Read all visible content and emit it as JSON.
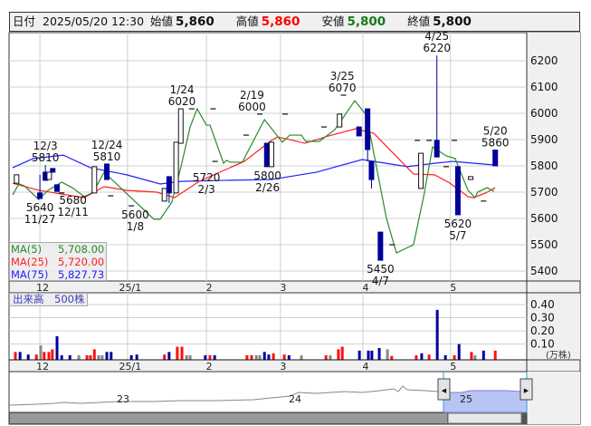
{
  "header": {
    "date_label": "日付",
    "datetime": "2025/05/20 12:30",
    "open_label": "始値",
    "open": "5,860",
    "high_label": "高値",
    "high": "5,860",
    "low_label": "安値",
    "low": "5,800",
    "close_label": "終値",
    "close": "5,800"
  },
  "colors": {
    "up": "#ffffff",
    "down": "#00009a",
    "ma5": "#2a8a2a",
    "ma25": "#ff2020",
    "ma75": "#2020ff",
    "vol_up": "#ff1010",
    "vol_down": "#0000a0",
    "vol_flat": "#888888",
    "high_value": "#ff0000",
    "low_value": "#1a7a1a"
  },
  "legend": [
    {
      "name": "MA(5)",
      "value": "5,708.00",
      "color": "#2a8a2a"
    },
    {
      "name": "MA(25)",
      "value": "5,720.00",
      "color": "#ff2020"
    },
    {
      "name": "MA(75)",
      "value": "5,827.73",
      "color": "#2020ff"
    }
  ],
  "volume_panel": {
    "title": "出来高　500株",
    "unit": "(万株)"
  },
  "navigator": {
    "year_labels": [
      "23",
      "24",
      "25"
    ]
  },
  "chart_data": {
    "type": "candlestick",
    "price_axis": {
      "ticks": [
        6200,
        6100,
        6000,
        5900,
        5800,
        5700,
        5600,
        5500,
        5400
      ]
    },
    "month_labels": [
      {
        "day": 7,
        "label": "12"
      },
      {
        "day": 29.5,
        "label": "25/1"
      },
      {
        "day": 49.8,
        "label": "2"
      },
      {
        "day": 68.8,
        "label": "3"
      },
      {
        "day": 90,
        "label": "4"
      },
      {
        "day": 112.5,
        "label": "5"
      }
    ],
    "candles": [
      {
        "day": 1,
        "o": 5734,
        "h": 5766,
        "l": 5734,
        "c": 5766
      },
      {
        "day": 7,
        "o": 5697,
        "h": 5766,
        "l": 5676,
        "c": 5676
      },
      {
        "day": 8.4,
        "o": 5776,
        "h": 5803,
        "l": 5745,
        "c": 5745
      },
      {
        "day": 9.4,
        "o": 5748,
        "h": 5776,
        "l": 5748,
        "c": 5776
      },
      {
        "day": 10.3,
        "o": 5790,
        "h": 5790,
        "l": 5776,
        "c": 5776
      },
      {
        "day": 11.4,
        "o": 5728,
        "h": 5728,
        "l": 5703,
        "c": 5703
      },
      {
        "day": 12.6,
        "o": 5697,
        "h": 5697,
        "l": 5697,
        "c": 5697
      },
      {
        "day": 21,
        "o": 5697,
        "h": 5797,
        "l": 5697,
        "c": 5797
      },
      {
        "day": 24.2,
        "o": 5807,
        "h": 5807,
        "l": 5748,
        "c": 5748
      },
      {
        "day": 25.2,
        "o": 5686,
        "h": 5686,
        "l": 5686,
        "c": 5686
      },
      {
        "day": 30.5,
        "o": 5648,
        "h": 5648,
        "l": 5648,
        "c": 5648
      },
      {
        "day": 39,
        "o": 5666,
        "h": 5714,
        "l": 5666,
        "c": 5714
      },
      {
        "day": 40.2,
        "o": 5759,
        "h": 5759,
        "l": 5659,
        "c": 5697
      },
      {
        "day": 42,
        "o": 5697,
        "h": 5890,
        "l": 5697,
        "c": 5890
      },
      {
        "day": 43.2,
        "o": 5886,
        "h": 6017,
        "l": 5886,
        "c": 6017
      },
      {
        "day": 46,
        "o": 6017,
        "h": 6017,
        "l": 6017,
        "c": 6017
      },
      {
        "day": 51.5,
        "o": 6017,
        "h": 6017,
        "l": 6017,
        "c": 6017
      },
      {
        "day": 52,
        "o": 5817,
        "h": 5817,
        "l": 5817,
        "c": 5817
      },
      {
        "day": 60,
        "o": 5917,
        "h": 5917,
        "l": 5917,
        "c": 5917
      },
      {
        "day": 63.5,
        "o": 5997,
        "h": 5997,
        "l": 5997,
        "c": 5997
      },
      {
        "day": 65.3,
        "o": 5886,
        "h": 5886,
        "l": 5797,
        "c": 5797
      },
      {
        "day": 66.5,
        "o": 5797,
        "h": 5890,
        "l": 5797,
        "c": 5890
      },
      {
        "day": 70,
        "o": 5997,
        "h": 5997,
        "l": 5997,
        "c": 5997
      },
      {
        "day": 80,
        "o": 5948,
        "h": 5948,
        "l": 5948,
        "c": 5948
      },
      {
        "day": 84,
        "o": 5948,
        "h": 5997,
        "l": 5948,
        "c": 5997
      },
      {
        "day": 85,
        "o": 6069,
        "h": 6069,
        "l": 6069,
        "c": 6069
      },
      {
        "day": 89,
        "o": 5948,
        "h": 5948,
        "l": 5914,
        "c": 5914
      },
      {
        "day": 91.2,
        "o": 6017,
        "h": 6017,
        "l": 5817,
        "c": 5862
      },
      {
        "day": 92.2,
        "o": 5817,
        "h": 5817,
        "l": 5714,
        "c": 5748
      },
      {
        "day": 94.5,
        "o": 5548,
        "h": 5548,
        "l": 5441,
        "c": 5441
      },
      {
        "day": 97.5,
        "o": 5500,
        "h": 5500,
        "l": 5500,
        "c": 5500
      },
      {
        "day": 104,
        "o": 5897,
        "h": 5897,
        "l": 5897,
        "c": 5897
      },
      {
        "day": 104.9,
        "o": 5714,
        "h": 5848,
        "l": 5714,
        "c": 5848
      },
      {
        "day": 107,
        "o": 5897,
        "h": 5897,
        "l": 5897,
        "c": 5897
      },
      {
        "day": 109,
        "o": 5897,
        "h": 6220,
        "l": 5834,
        "c": 5834
      },
      {
        "day": 111.4,
        "o": 5797,
        "h": 5797,
        "l": 5797,
        "c": 5797
      },
      {
        "day": 113.5,
        "o": 5897,
        "h": 5897,
        "l": 5897,
        "c": 5897
      },
      {
        "day": 114.4,
        "o": 5797,
        "h": 5797,
        "l": 5614,
        "c": 5614
      },
      {
        "day": 117.7,
        "o": 5748,
        "h": 5759,
        "l": 5748,
        "c": 5759
      },
      {
        "day": 121,
        "o": 5666,
        "h": 5666,
        "l": 5666,
        "c": 5666
      },
      {
        "day": 124,
        "o": 5860,
        "h": 5860,
        "l": 5800,
        "c": 5800
      }
    ],
    "ma5": [
      [
        0,
        5690
      ],
      [
        1.6,
        5731
      ],
      [
        3,
        5724
      ],
      [
        6.7,
        5672
      ],
      [
        9.1,
        5707
      ],
      [
        12.6,
        5738
      ],
      [
        15.3,
        5717
      ],
      [
        18.4,
        5683
      ],
      [
        20.7,
        5700
      ],
      [
        23.5,
        5776
      ],
      [
        27.7,
        5717
      ],
      [
        30.9,
        5672
      ],
      [
        36.3,
        5597
      ],
      [
        37.9,
        5597
      ],
      [
        40.9,
        5662
      ],
      [
        43.3,
        5800
      ],
      [
        45.6,
        5948
      ],
      [
        47.4,
        6017
      ],
      [
        49.8,
        5955
      ],
      [
        50.7,
        5955
      ],
      [
        54.2,
        5810
      ],
      [
        54.9,
        5821
      ],
      [
        56,
        5814
      ],
      [
        59,
        5814
      ],
      [
        64.7,
        5976
      ],
      [
        69.3,
        5890
      ],
      [
        71.2,
        5917
      ],
      [
        74.2,
        5917
      ],
      [
        75.3,
        5893
      ],
      [
        78.8,
        5893
      ],
      [
        82.8,
        5938
      ],
      [
        87.9,
        6048
      ],
      [
        90.9,
        5993
      ],
      [
        96,
        5603
      ],
      [
        98.6,
        5469
      ],
      [
        103,
        5500
      ],
      [
        105.6,
        5683
      ],
      [
        107.9,
        5872
      ],
      [
        111.4,
        5838
      ],
      [
        113.7,
        5828
      ],
      [
        117,
        5707
      ],
      [
        118.8,
        5679
      ],
      [
        119.5,
        5700
      ],
      [
        121.9,
        5717
      ],
      [
        123.7,
        5703
      ]
    ],
    "ma25": [
      [
        0,
        5734
      ],
      [
        6.7,
        5707
      ],
      [
        18.4,
        5679
      ],
      [
        23.5,
        5721
      ],
      [
        29.3,
        5707
      ],
      [
        37,
        5700
      ],
      [
        41.6,
        5679
      ],
      [
        47.9,
        5741
      ],
      [
        59.5,
        5817
      ],
      [
        66.5,
        5897
      ],
      [
        68.1,
        5910
      ],
      [
        75.1,
        5886
      ],
      [
        81.2,
        5914
      ],
      [
        88.1,
        5941
      ],
      [
        92.8,
        5924
      ],
      [
        103,
        5769
      ],
      [
        108.4,
        5766
      ],
      [
        112.3,
        5735
      ],
      [
        117,
        5683
      ],
      [
        118.4,
        5679
      ],
      [
        121.6,
        5697
      ],
      [
        124,
        5717
      ]
    ],
    "ma75": [
      [
        0,
        5793
      ],
      [
        5.3,
        5828
      ],
      [
        13,
        5841
      ],
      [
        20,
        5793
      ],
      [
        29.3,
        5766
      ],
      [
        37.9,
        5731
      ],
      [
        43.3,
        5741
      ],
      [
        54.9,
        5745
      ],
      [
        66.5,
        5748
      ],
      [
        78.1,
        5776
      ],
      [
        89.8,
        5824
      ],
      [
        101.4,
        5797
      ],
      [
        108.4,
        5810
      ],
      [
        113,
        5817
      ],
      [
        124,
        5803
      ]
    ],
    "annotations": [
      {
        "day": 8.4,
        "price": 5803,
        "pos": "above",
        "date": "12/3",
        "value": "5810"
      },
      {
        "day": 7,
        "price": 5676,
        "pos": "below",
        "date": "11/27",
        "value": "5640"
      },
      {
        "day": 15.5,
        "price": 5703,
        "pos": "below",
        "date": "12/11",
        "value": "5680"
      },
      {
        "day": 24.2,
        "price": 5807,
        "pos": "above",
        "date": "12/24",
        "value": "5810"
      },
      {
        "day": 31.5,
        "price": 5648,
        "pos": "below",
        "date": "1/8",
        "value": "5600"
      },
      {
        "day": 43.5,
        "price": 6017,
        "pos": "above",
        "date": "1/24",
        "value": "6020"
      },
      {
        "day": 49.8,
        "price": 5790,
        "pos": "below",
        "date": "2/3",
        "value": "5720"
      },
      {
        "day": 61.5,
        "price": 5997,
        "pos": "above",
        "date": "2/19",
        "value": "6000"
      },
      {
        "day": 65.5,
        "price": 5797,
        "pos": "below",
        "date": "2/26",
        "value": "5800"
      },
      {
        "day": 84.7,
        "price": 6069,
        "pos": "above",
        "date": "3/25",
        "value": "6070"
      },
      {
        "day": 94.5,
        "price": 5441,
        "pos": "below",
        "date": "4/7",
        "value": "5450"
      },
      {
        "day": 109,
        "price": 6220,
        "pos": "above",
        "date": "4/25",
        "value": "6220"
      },
      {
        "day": 124,
        "price": 5860,
        "pos": "above",
        "date": "5/20",
        "value": "5860"
      },
      {
        "day": 114.4,
        "price": 5614,
        "pos": "below",
        "date": "5/7",
        "value": "5620"
      }
    ],
    "volume_axis": {
      "ticks": [
        0.4,
        0.3,
        0.2,
        0.1
      ],
      "unit": "万株"
    },
    "volume": [
      {
        "day": 0.7,
        "v": 0.06,
        "dir": "up"
      },
      {
        "day": 1.9,
        "v": 0.06,
        "dir": "down"
      },
      {
        "day": 4,
        "v": 0.04,
        "dir": "down"
      },
      {
        "day": 6.1,
        "v": 0.04,
        "dir": "up"
      },
      {
        "day": 7.2,
        "v": 0.11,
        "dir": "flat"
      },
      {
        "day": 8.1,
        "v": 0.06,
        "dir": "up"
      },
      {
        "day": 9.3,
        "v": 0.06,
        "dir": "up"
      },
      {
        "day": 10.2,
        "v": 0.08,
        "dir": "up"
      },
      {
        "day": 11.4,
        "v": 0.18,
        "dir": "down"
      },
      {
        "day": 12.6,
        "v": 0.035,
        "dir": "down"
      },
      {
        "day": 14.7,
        "v": 0.035,
        "dir": "down"
      },
      {
        "day": 17,
        "v": 0.035,
        "dir": "flat"
      },
      {
        "day": 19.1,
        "v": 0.035,
        "dir": "up"
      },
      {
        "day": 20,
        "v": 0.035,
        "dir": "up"
      },
      {
        "day": 21,
        "v": 0.08,
        "dir": "up"
      },
      {
        "day": 22.1,
        "v": 0.035,
        "dir": "flat"
      },
      {
        "day": 23,
        "v": 0.035,
        "dir": "flat"
      },
      {
        "day": 24.2,
        "v": 0.06,
        "dir": "down"
      },
      {
        "day": 25.3,
        "v": 0.06,
        "dir": "down"
      },
      {
        "day": 30.5,
        "v": 0.035,
        "dir": "down"
      },
      {
        "day": 31.9,
        "v": 0.04,
        "dir": "down"
      },
      {
        "day": 39,
        "v": 0.04,
        "dir": "up"
      },
      {
        "day": 40.2,
        "v": 0.06,
        "dir": "down"
      },
      {
        "day": 42.3,
        "v": 0.1,
        "dir": "up"
      },
      {
        "day": 43.5,
        "v": 0.1,
        "dir": "up"
      },
      {
        "day": 44.7,
        "v": 0.035,
        "dir": "flat"
      },
      {
        "day": 45.6,
        "v": 0.035,
        "dir": "flat"
      },
      {
        "day": 49.5,
        "v": 0.035,
        "dir": "down"
      },
      {
        "day": 50.7,
        "v": 0.035,
        "dir": "up"
      },
      {
        "day": 51.9,
        "v": 0.035,
        "dir": "down"
      },
      {
        "day": 60.2,
        "v": 0.035,
        "dir": "up"
      },
      {
        "day": 61.4,
        "v": 0.035,
        "dir": "up"
      },
      {
        "day": 62.6,
        "v": 0.035,
        "dir": "flat"
      },
      {
        "day": 63.5,
        "v": 0.035,
        "dir": "flat"
      },
      {
        "day": 64.7,
        "v": 0.06,
        "dir": "down"
      },
      {
        "day": 65.8,
        "v": 0.04,
        "dir": "down"
      },
      {
        "day": 67,
        "v": 0.05,
        "dir": "up"
      },
      {
        "day": 69.8,
        "v": 0.04,
        "dir": "up"
      },
      {
        "day": 71,
        "v": 0.035,
        "dir": "down"
      },
      {
        "day": 74.2,
        "v": 0.035,
        "dir": "flat"
      },
      {
        "day": 80.5,
        "v": 0.035,
        "dir": "up"
      },
      {
        "day": 81.6,
        "v": 0.035,
        "dir": "flat"
      },
      {
        "day": 83.7,
        "v": 0.08,
        "dir": "up"
      },
      {
        "day": 84.7,
        "v": 0.1,
        "dir": "up"
      },
      {
        "day": 89.1,
        "v": 0.07,
        "dir": "down"
      },
      {
        "day": 91.4,
        "v": 0.07,
        "dir": "down"
      },
      {
        "day": 92.3,
        "v": 0.07,
        "dir": "down"
      },
      {
        "day": 94.2,
        "v": 0.09,
        "dir": "down"
      },
      {
        "day": 96.3,
        "v": 0.08,
        "dir": "flat"
      },
      {
        "day": 97.4,
        "v": 0.03,
        "dir": "up"
      },
      {
        "day": 103.7,
        "v": 0.035,
        "dir": "up"
      },
      {
        "day": 105.1,
        "v": 0.05,
        "dir": "down"
      },
      {
        "day": 107,
        "v": 0.04,
        "dir": "up"
      },
      {
        "day": 109.1,
        "v": 0.38,
        "dir": "down"
      },
      {
        "day": 111.2,
        "v": 0.035,
        "dir": "down"
      },
      {
        "day": 113.5,
        "v": 0.035,
        "dir": "up"
      },
      {
        "day": 114.7,
        "v": 0.12,
        "dir": "down"
      },
      {
        "day": 117.9,
        "v": 0.06,
        "dir": "up"
      },
      {
        "day": 118.8,
        "v": 0.035,
        "dir": "flat"
      },
      {
        "day": 121,
        "v": 0.07,
        "dir": "down"
      },
      {
        "day": 124,
        "v": 0.07,
        "dir": "up"
      }
    ]
  }
}
